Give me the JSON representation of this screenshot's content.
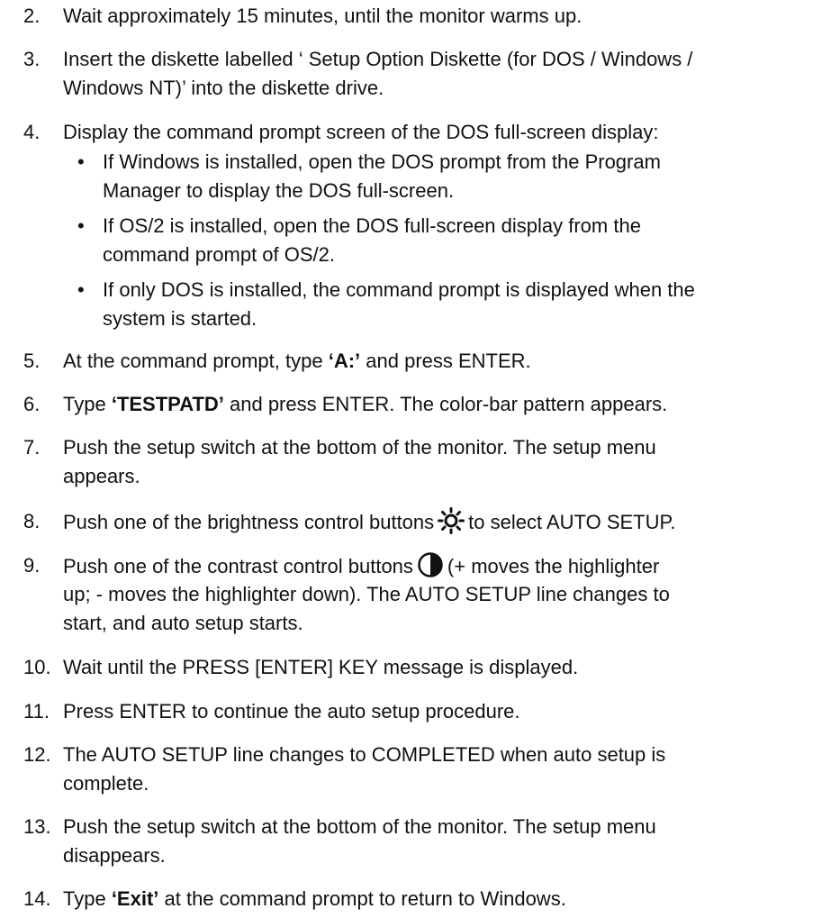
{
  "steps": [
    {
      "num": "2.",
      "lines": [
        "Wait approximately 15 minutes, until the monitor warms up."
      ]
    },
    {
      "num": "3.",
      "lines": [
        "Insert the diskette labelled ‘ Setup Option Diskette (for DOS / Windows /",
        "Windows NT)’ into the diskette drive."
      ]
    },
    {
      "num": "4.",
      "lines": [
        "Display the command prompt screen of the DOS full-screen display:"
      ]
    },
    {
      "num": "5.",
      "pre": "At the command prompt, type ",
      "bold": "‘A:’",
      "post": " and press ENTER."
    },
    {
      "num": "6.",
      "pre": "Type ",
      "bold": "‘TESTPATD’",
      "post": " and press ENTER.  The color-bar pattern appears."
    },
    {
      "num": "7.",
      "lines": [
        "Push the setup switch at the bottom of the monitor.  The setup menu",
        "appears."
      ]
    },
    {
      "num": "8.",
      "pre": "Push one of the brightness control buttons",
      "icon": "brightness-icon",
      "post": "to select AUTO SETUP."
    },
    {
      "num": "9.",
      "pre": "Push one of the contrast control buttons",
      "icon": "contrast-icon",
      "post": "(+ moves the highlighter",
      "lines": [
        "up; - moves the highlighter down).  The AUTO SETUP line changes to",
        "start, and auto setup starts."
      ]
    },
    {
      "num": "10.",
      "lines": [
        "Wait until the PRESS [ENTER] KEY message is displayed."
      ]
    },
    {
      "num": "11.",
      "lines": [
        "Press ENTER to continue the auto setup procedure."
      ]
    },
    {
      "num": "12.",
      "lines": [
        "The AUTO SETUP line changes to COMPLETED when auto setup is",
        "complete."
      ]
    },
    {
      "num": "13.",
      "lines": [
        "Push the setup switch at the bottom of the monitor.  The setup menu",
        "disappears."
      ]
    },
    {
      "num": "14.",
      "pre": "Type ",
      "bold": "‘Exit’",
      "post": " at the command prompt to return to Windows."
    }
  ],
  "bullets": [
    {
      "dot": "•",
      "lines": [
        "If Windows is installed, open the DOS prompt from the Program",
        "Manager to display the DOS full-screen."
      ]
    },
    {
      "dot": "•",
      "lines": [
        "If OS/2 is installed, open the DOS full-screen display from the",
        "command prompt of OS/2."
      ]
    },
    {
      "dot": "•",
      "lines": [
        "If only DOS is installed, the command prompt is displayed when the",
        "system is started."
      ]
    }
  ]
}
